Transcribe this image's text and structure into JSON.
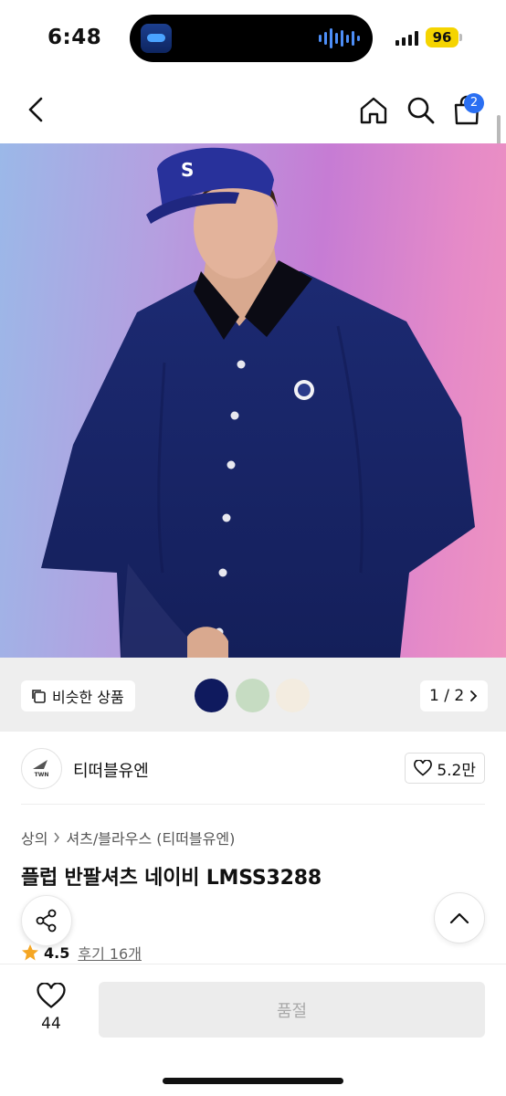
{
  "status_bar": {
    "time": "6:48",
    "battery": "96"
  },
  "nav": {
    "cart_count": "2"
  },
  "hero": {
    "similar_label": "비슷한 상품",
    "page_indicator": "1 / 2",
    "swatches": [
      "#0f1a5e",
      "#c6dcc2",
      "#f3ece0"
    ]
  },
  "brand": {
    "name": "티떠블유엔",
    "logo_text": "TWN",
    "likes": "5.2만"
  },
  "product": {
    "breadcrumb": [
      "상의",
      "셔츠/블라우스 (티떠블유엔)"
    ],
    "title": "플럽 반팔셔츠 네이비 LMSS3288",
    "rating": "4.5",
    "reviews": "후기 16개"
  },
  "bottom": {
    "wish_count": "44",
    "buy_label": "품절"
  },
  "colors": {
    "accent": "#2a6ff2",
    "rating_star": "#f5a623"
  }
}
